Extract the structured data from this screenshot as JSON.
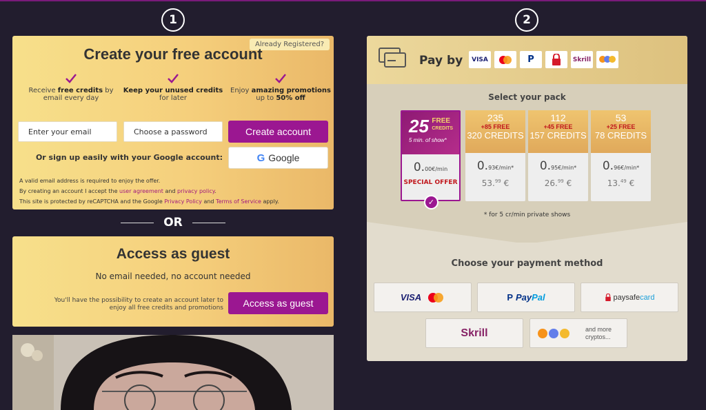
{
  "steps": {
    "one": "1",
    "two": "2"
  },
  "create": {
    "already_registered": "Already Registered?",
    "title": "Create your free account",
    "benefits": [
      {
        "pre": "Receive ",
        "bold": "free credits",
        "post": " by email every day"
      },
      {
        "pre": "",
        "bold": "Keep your unused credits",
        "post": " for later"
      },
      {
        "pre": "Enjoy ",
        "bold": "amazing promotions",
        "post": " up to ",
        "bold2": "50% off"
      }
    ],
    "email_placeholder": "Enter your email",
    "password_placeholder": "Choose a password",
    "create_button": "Create account",
    "google_prompt": "Or sign up easily with your Google account:",
    "google_button": "Google",
    "fine1": "A valid email address is required to enjoy the offer.",
    "fine2_pre": "By creating an account I accept the ",
    "fine2_link1": "user agreement",
    "fine2_mid": " and ",
    "fine2_link2": "privacy policy",
    "fine2_post": ".",
    "fine3_pre": "This site is protected by reCAPTCHA and the Google ",
    "fine3_link1": "Privacy Policy",
    "fine3_mid": " and ",
    "fine3_link2": "Terms of Service",
    "fine3_post": " apply."
  },
  "or_label": "OR",
  "guest": {
    "title": "Access as guest",
    "subtitle": "No email needed, no account needed",
    "note": "You'll have the possibility to create an account later to enjoy all free credits and promotions",
    "button": "Access as guest"
  },
  "pay": {
    "pay_by": "Pay by",
    "logos": [
      "VISA",
      "MasterCard",
      "PayPal",
      "lock",
      "Skrill",
      "cryptos"
    ],
    "select_pack": "Select your pack",
    "packs": [
      {
        "big": "25",
        "free_label": "FREE",
        "credits_label": "CREDITS",
        "show": "5 min. of show*",
        "price_int": "0.",
        "price_dec": "00€",
        "unit": "/min",
        "special": "SPECIAL OFFER"
      },
      {
        "n": "235",
        "free": "+85 FREE",
        "credits": "320 CREDITS",
        "price_int": "0.",
        "price_dec": "93€",
        "unit": "/min*",
        "total_int": "53.",
        "total_dec": "99",
        "currency": "€"
      },
      {
        "n": "112",
        "free": "+45 FREE",
        "credits": "157 CREDITS",
        "price_int": "0.",
        "price_dec": "95€",
        "unit": "/min*",
        "total_int": "26.",
        "total_dec": "99",
        "currency": "€"
      },
      {
        "n": "53",
        "free": "+25 FREE",
        "credits": "78 CREDITS",
        "price_int": "0.",
        "price_dec": "96€",
        "unit": "/min*",
        "total_int": "13.",
        "total_dec": "49",
        "currency": "€"
      }
    ],
    "footnote": "* for 5 cr/min private shows",
    "choose_method": "Choose your payment method",
    "methods": {
      "visa": "VISA",
      "mastercard": "MasterCard",
      "paypal_pay": "Pay",
      "paypal_pal": "Pal",
      "paysafe_a": "paysafe",
      "paysafe_b": "card",
      "skrill": "Skrill",
      "crypto_text": "and more cryptos..."
    }
  },
  "colors": {
    "accent_purple": "#9b1791",
    "panel_gold": "#f5cf7c",
    "background": "#221d2e",
    "offer_red": "#c0161b"
  }
}
